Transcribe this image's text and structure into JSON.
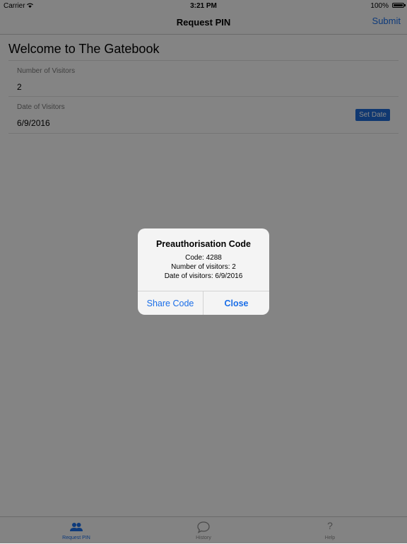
{
  "status_bar": {
    "carrier": "Carrier",
    "time": "3:21 PM",
    "battery": "100%"
  },
  "navbar": {
    "title": "Request PIN",
    "submit_label": "Submit"
  },
  "form": {
    "heading": "Welcome to The Gatebook",
    "visitors_label": "Number of Visitors",
    "visitors_value": "2",
    "date_label": "Date of Visitors",
    "date_value": "6/9/2016",
    "set_date_label": "Set Date"
  },
  "tabs": [
    {
      "label": "Request PIN",
      "icon": "people-icon",
      "active": true
    },
    {
      "label": "History",
      "icon": "chat-bubble-icon",
      "active": false
    },
    {
      "label": "Help",
      "icon": "question-icon",
      "glyph": "?",
      "active": false
    }
  ],
  "alert": {
    "title": "Preauthorisation Code",
    "lines": [
      "Code: 4288",
      "Number of visitors: 2",
      "Date of visitors: 6/9/2016"
    ],
    "share_label": "Share Code",
    "close_label": "Close"
  },
  "colors": {
    "accent": "#1a6ee8",
    "button_blue": "#1f6bd6",
    "overlay": "rgba(0,0,0,0.47)"
  }
}
